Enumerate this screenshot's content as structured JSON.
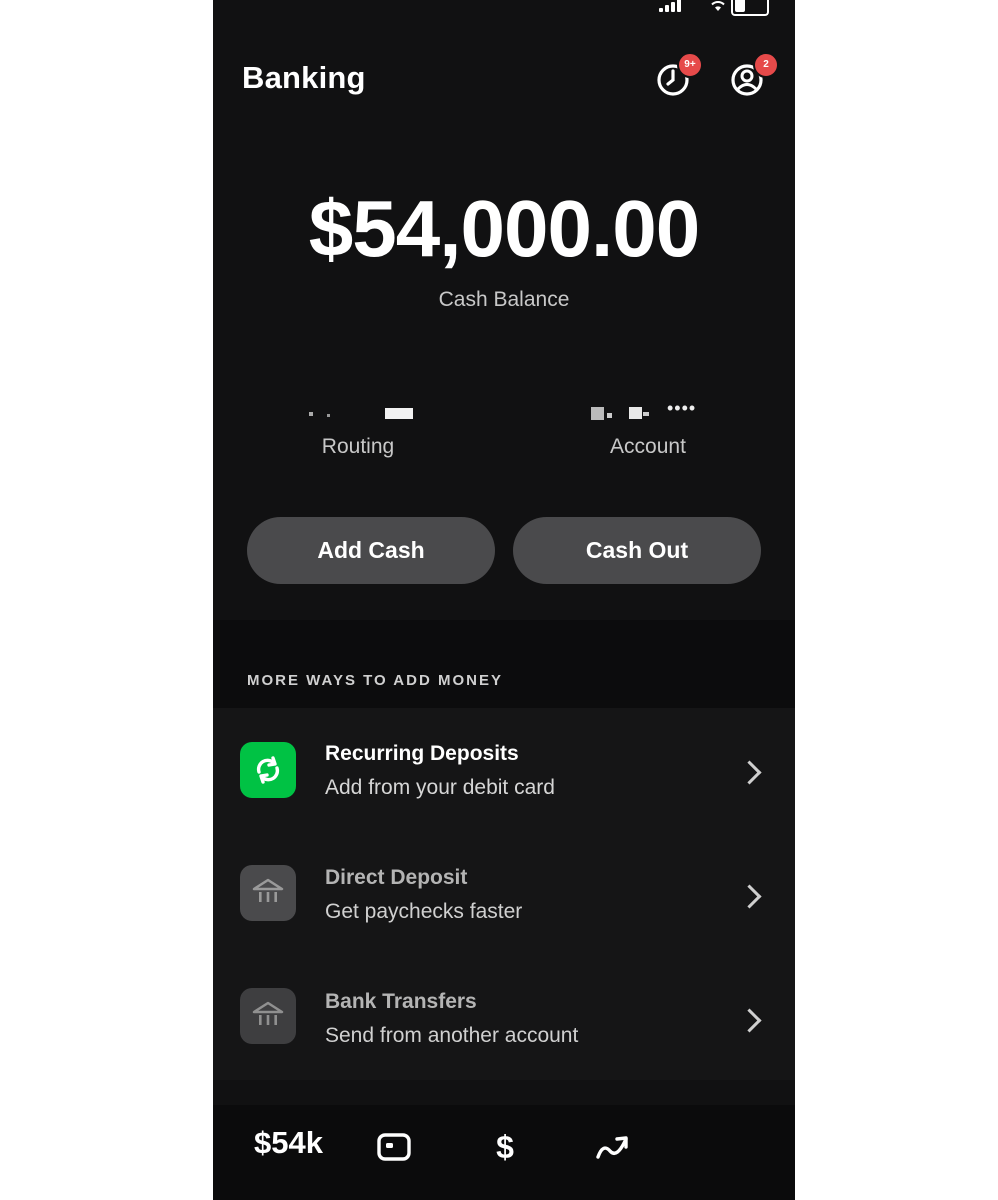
{
  "header": {
    "title": "Banking",
    "activity_badge": "9+",
    "profile_badge": "2"
  },
  "balance": {
    "amount": "$54,000.00",
    "label": "Cash Balance"
  },
  "account_info": {
    "routing_label": "Routing",
    "account_label": "Account",
    "account_mask": "••••"
  },
  "actions": {
    "add_cash": "Add Cash",
    "cash_out": "Cash Out"
  },
  "more_ways": {
    "section_title": "MORE WAYS TO ADD MONEY",
    "items": [
      {
        "title": "Recurring Deposits",
        "subtitle": "Add from your debit card",
        "icon": "refresh-icon"
      },
      {
        "title": "Direct Deposit",
        "subtitle": "Get paychecks faster",
        "icon": "bank-icon"
      },
      {
        "title": "Bank Transfers",
        "subtitle": "Send from another account",
        "icon": "bank-icon"
      }
    ]
  },
  "bottom_nav": {
    "balance_short": "$54k",
    "icons": [
      "card-icon",
      "dollar-icon",
      "investing-icon"
    ]
  },
  "colors": {
    "background": "#111112",
    "pill": "#4a4a4c",
    "accent_green": "#00c244",
    "badge_red": "#e64a4a"
  }
}
